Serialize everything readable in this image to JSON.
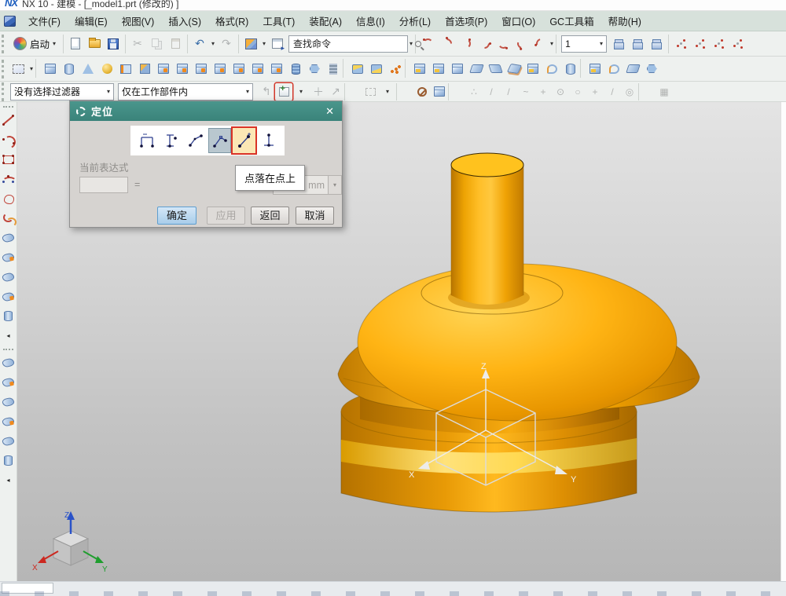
{
  "window": {
    "logo": "NX",
    "title": "NX 10 - 建模 - [_model1.prt (修改的) ]"
  },
  "menu_bar": {
    "items": [
      "文件(F)",
      "编辑(E)",
      "视图(V)",
      "插入(S)",
      "格式(R)",
      "工具(T)",
      "装配(A)",
      "信息(I)",
      "分析(L)",
      "首选项(P)",
      "窗口(O)",
      "GC工具箱",
      "帮助(H)"
    ]
  },
  "toolbar_quick": {
    "start_label": "启动",
    "start_caret": "▾",
    "search_text": "查找命令",
    "more_caret": "▾",
    "layer_value": "1",
    "file_icons": [
      {
        "name": "new-file-icon",
        "cls": "sh-page"
      },
      {
        "name": "open-file-icon",
        "cls": "sh-folder"
      },
      {
        "name": "save-icon",
        "cls": "sh-disk"
      }
    ],
    "edit_icons": [
      {
        "name": "cut-icon",
        "cls": "sh-glyph dis",
        "glyph": "✂"
      },
      {
        "name": "copy-icon",
        "cls": "sh-copy dis"
      },
      {
        "name": "paste-icon",
        "cls": "sh-paste dis"
      }
    ],
    "undo_icons": [
      {
        "name": "undo-icon",
        "cls": "sh-glyph blue",
        "glyph": "↶"
      },
      {
        "name": "undo-dropdown-arrow",
        "cls": "sh-caret",
        "glyph": "▾"
      },
      {
        "name": "redo-icon",
        "cls": "sh-glyph dis",
        "glyph": "↷"
      }
    ],
    "view_icons": [
      {
        "name": "shaded-display-icon",
        "cls": "sh-box3d"
      },
      {
        "name": "display-dropdown-arrow",
        "cls": "sh-caret",
        "glyph": "▾"
      },
      {
        "name": "window-info-icon",
        "cls": "sh-info"
      }
    ],
    "curve_icons": [
      {
        "name": "curve-fillet-icon",
        "cls": "sh-arc"
      },
      {
        "name": "curve-trim-icon",
        "cls": "sh-arc a2"
      },
      {
        "name": "curve-cross-icon",
        "cls": "sh-arc a3"
      },
      {
        "name": "curve-corner-icon",
        "cls": "sh-arc a4"
      },
      {
        "name": "curve-bend-icon",
        "cls": "sh-arc a5"
      },
      {
        "name": "curve-arc-icon",
        "cls": "sh-arc a6"
      },
      {
        "name": "curve-edit-icon",
        "cls": "sh-arc a7"
      }
    ],
    "layer_icons": [
      {
        "name": "layer-settings-icon",
        "cls": "sh-layers"
      },
      {
        "name": "layer-visible-in-view-icon",
        "cls": "sh-layers"
      },
      {
        "name": "layer-category-icon",
        "cls": "sh-layers"
      }
    ],
    "point_icons": [
      {
        "name": "datum-point-icon",
        "cls": "sh-pts"
      },
      {
        "name": "point-set-icon",
        "cls": "sh-pts"
      },
      {
        "name": "datum-axis-icon",
        "cls": "sh-pts"
      },
      {
        "name": "datum-csys-icon",
        "cls": "sh-pts"
      }
    ]
  },
  "toolbar_features": {
    "icons": [
      {
        "name": "sketch-icon",
        "cls": "f-sk"
      },
      {
        "name": "sketch-dropdown-arrow",
        "cls": "sh-caret",
        "glyph": "▾"
      },
      {
        "name": "separator",
        "cls": "tsep"
      },
      {
        "name": "block-icon",
        "cls": "f-cube"
      },
      {
        "name": "cylinder-icon",
        "cls": "f-cyl"
      },
      {
        "name": "cone-icon",
        "cls": "f-cone"
      },
      {
        "name": "sphere-icon",
        "cls": "f-sph"
      },
      {
        "name": "pattern-feature-icon",
        "cls": "f-book"
      },
      {
        "name": "wedge-icon",
        "cls": "f-wedge"
      },
      {
        "name": "nx5-hole-icon",
        "cls": "f-cube o"
      },
      {
        "name": "hole-icon",
        "cls": "f-cube o"
      },
      {
        "name": "boss-icon",
        "cls": "f-cube o"
      },
      {
        "name": "pocket-icon",
        "cls": "f-cube o"
      },
      {
        "name": "pad-icon",
        "cls": "f-cube o"
      },
      {
        "name": "slot-icon",
        "cls": "f-cube o"
      },
      {
        "name": "groove-icon",
        "cls": "f-cube o"
      },
      {
        "name": "thread-icon",
        "cls": "f-cylb"
      },
      {
        "name": "surface-check-icon",
        "cls": "f-hex"
      },
      {
        "name": "grid-icon",
        "cls": "f-grid"
      },
      {
        "name": "separator",
        "cls": "tsep"
      },
      {
        "name": "pattern-up-icon",
        "cls": "f-bool"
      },
      {
        "name": "pattern-fan-icon",
        "cls": "f-bool b2"
      },
      {
        "name": "pattern-dots-icon",
        "cls": "f-dots"
      },
      {
        "name": "separator",
        "cls": "tsep"
      },
      {
        "name": "unite-icon",
        "cls": "f-cube y"
      },
      {
        "name": "subtract-icon",
        "cls": "f-cube y"
      },
      {
        "name": "intersect-icon",
        "cls": "f-cube"
      },
      {
        "name": "trim-body-icon",
        "cls": "f-sheet"
      },
      {
        "name": "split-body-icon",
        "cls": "f-sheet s2"
      },
      {
        "name": "offset-face-icon",
        "cls": "f-sheet s3"
      },
      {
        "name": "sew-icon",
        "cls": "f-cube y"
      },
      {
        "name": "patch-icon",
        "cls": "f-swirl"
      },
      {
        "name": "thicken-icon",
        "cls": "f-cyl"
      },
      {
        "name": "separator",
        "cls": "tsep"
      },
      {
        "name": "shell-icon",
        "cls": "f-cube y"
      },
      {
        "name": "flexible-bend-icon",
        "cls": "f-swirl"
      },
      {
        "name": "box-cut-icon",
        "cls": "f-sheet"
      },
      {
        "name": "wire-sphere-icon",
        "cls": "f-hex"
      }
    ]
  },
  "selection_bar": {
    "filter_value": "没有选择过滤器",
    "scope_value": "仅在工作部件内",
    "caret": "▾",
    "icons": [
      {
        "name": "highlight-related-icon",
        "cls": "sh-glyph dis",
        "glyph": "↰"
      },
      {
        "name": "snap-enabled-icon",
        "cls": "sh-plusbox hot2"
      },
      {
        "name": "snap-dropdown-arrow",
        "cls": "sh-caret",
        "glyph": "▾"
      },
      {
        "name": "select-add-icon",
        "cls": "sh-glyph dis",
        "glyph": "＋"
      },
      {
        "name": "deselect-icon",
        "cls": "sh-glyph dis",
        "glyph": "↗"
      },
      {
        "name": "separator",
        "cls": "tsep"
      },
      {
        "name": "rectangle-select-icon",
        "cls": "sh-rectsel dis"
      },
      {
        "name": "select-dropdown-arrow",
        "cls": "sh-caret",
        "glyph": "▾"
      },
      {
        "name": "separator",
        "cls": "tsep"
      },
      {
        "name": "stop-selection-icon",
        "cls": "sh-stop"
      },
      {
        "name": "work-part-icon",
        "cls": "f-cube"
      },
      {
        "name": "separator",
        "cls": "tsep"
      },
      {
        "name": "snap-point-cloud-icon",
        "cls": "snapg dis",
        "glyph": "∴"
      },
      {
        "name": "snap-end-point-icon",
        "cls": "snapg dis",
        "glyph": "/"
      },
      {
        "name": "snap-mid-point-icon",
        "cls": "snapg dis",
        "glyph": "/"
      },
      {
        "name": "snap-spline-icon",
        "cls": "snapg dis",
        "glyph": "~"
      },
      {
        "name": "snap-pole-icon",
        "cls": "snapg dis",
        "glyph": "+"
      },
      {
        "name": "snap-arc-center-icon",
        "cls": "snapg dis",
        "glyph": "⊙"
      },
      {
        "name": "snap-quadrant-icon",
        "cls": "snapg dis",
        "glyph": "○"
      },
      {
        "name": "snap-intersection-icon",
        "cls": "snapg dis",
        "glyph": "+"
      },
      {
        "name": "snap-point-on-curve-icon",
        "cls": "snapg dis",
        "glyph": "/"
      },
      {
        "name": "snap-point-on-face-icon",
        "cls": "snapg dis",
        "glyph": "◎"
      },
      {
        "name": "separator",
        "cls": "tsep"
      },
      {
        "name": "grid-snap-icon",
        "cls": "snapg dis",
        "glyph": "▦"
      }
    ]
  },
  "left_toolbar": {
    "icons": [
      {
        "name": "rail-drag-handle",
        "cls": "l-handle"
      },
      {
        "name": "line-icon",
        "cls": "l-svg l-line"
      },
      {
        "name": "arc-icon",
        "cls": "l-svg l-arc"
      },
      {
        "name": "rectangle-icon",
        "cls": "l-svg l-rect"
      },
      {
        "name": "studio-spline-icon",
        "cls": "l-svg l-spline"
      },
      {
        "name": "art-spline-icon",
        "cls": "l-svg l-blob"
      },
      {
        "name": "helix-icon",
        "cls": "l-svg l-scurve"
      },
      {
        "name": "ruled-surface-icon",
        "cls": "l-sheet"
      },
      {
        "name": "through-curves-icon",
        "cls": "l-sheet o"
      },
      {
        "name": "swept-surface-icon",
        "cls": "l-sheet"
      },
      {
        "name": "n-sided-surface-icon",
        "cls": "l-sheet o"
      },
      {
        "name": "extrude-sheet-icon",
        "cls": "l-cyl"
      },
      {
        "name": "more-commands-arrow",
        "cls": "l-more",
        "glyph": "◂"
      },
      {
        "name": "rail-drag-handle",
        "cls": "l-handle"
      },
      {
        "name": "four-point-surface-icon",
        "cls": "l-sheet"
      },
      {
        "name": "mesh-surface-icon",
        "cls": "l-sheet o"
      },
      {
        "name": "bounded-plane-icon",
        "cls": "l-sheet"
      },
      {
        "name": "curve-mesh-icon",
        "cls": "l-sheet o"
      },
      {
        "name": "bridge-surface-icon",
        "cls": "l-sheet"
      },
      {
        "name": "tube-icon",
        "cls": "l-cyl"
      },
      {
        "name": "more-commands-arrow",
        "cls": "l-more",
        "glyph": "◂"
      }
    ]
  },
  "dialog": {
    "title": "定位",
    "close_glyph": "✕",
    "position_icons": [
      {
        "name": "position-horizontal-icon",
        "state": "normal"
      },
      {
        "name": "position-vertical-icon",
        "state": "normal"
      },
      {
        "name": "position-parallel-icon",
        "state": "normal"
      },
      {
        "name": "position-perpendicular-icon",
        "state": "selected"
      },
      {
        "name": "position-point-to-point-icon",
        "state": "highlighted-red-box"
      },
      {
        "name": "position-point-on-line-icon",
        "state": "normal"
      }
    ],
    "expression_label": "当前表达式",
    "equals": "=",
    "unit": "mm",
    "unit_caret": "▾",
    "tooltip": "点落在点上",
    "buttons": {
      "ok": "确定",
      "apply": "应用",
      "back": "返回",
      "cancel": "取消"
    }
  },
  "viewport": {
    "part_color": "#f5a400",
    "part_description": "orange turned mushroom-shaped solid: stem cylinder, dome, flared skirt, grooved base cylinder",
    "triad": {
      "x": "X",
      "y": "Y",
      "z": "Z"
    },
    "wcs": {
      "x": "X",
      "y": "Y",
      "z": "Z"
    }
  }
}
